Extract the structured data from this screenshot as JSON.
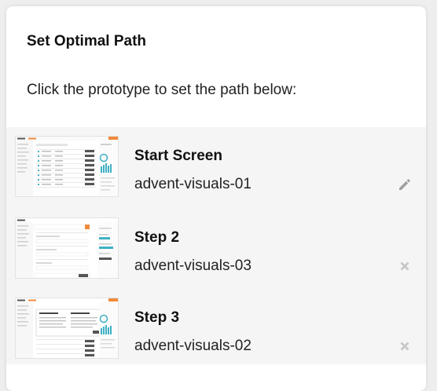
{
  "panel": {
    "title": "Set Optimal Path",
    "instruction": "Click the prototype to set the path below:"
  },
  "steps": [
    {
      "name": "Start Screen",
      "screen": "advent-visuals-01",
      "action_icon": "pencil-icon",
      "thumb_variant": "dashboard"
    },
    {
      "name": "Step 2",
      "screen": "advent-visuals-03",
      "action_icon": "remove-icon",
      "thumb_variant": "form"
    },
    {
      "name": "Step 3",
      "screen": "advent-visuals-02",
      "action_icon": "remove-icon",
      "thumb_variant": "modal"
    }
  ],
  "colors": {
    "accent": "#f28a3c",
    "teal": "#3fb0c4",
    "icon_gray": "#c8c8c8",
    "pencil_gray": "#9e9e9e"
  }
}
